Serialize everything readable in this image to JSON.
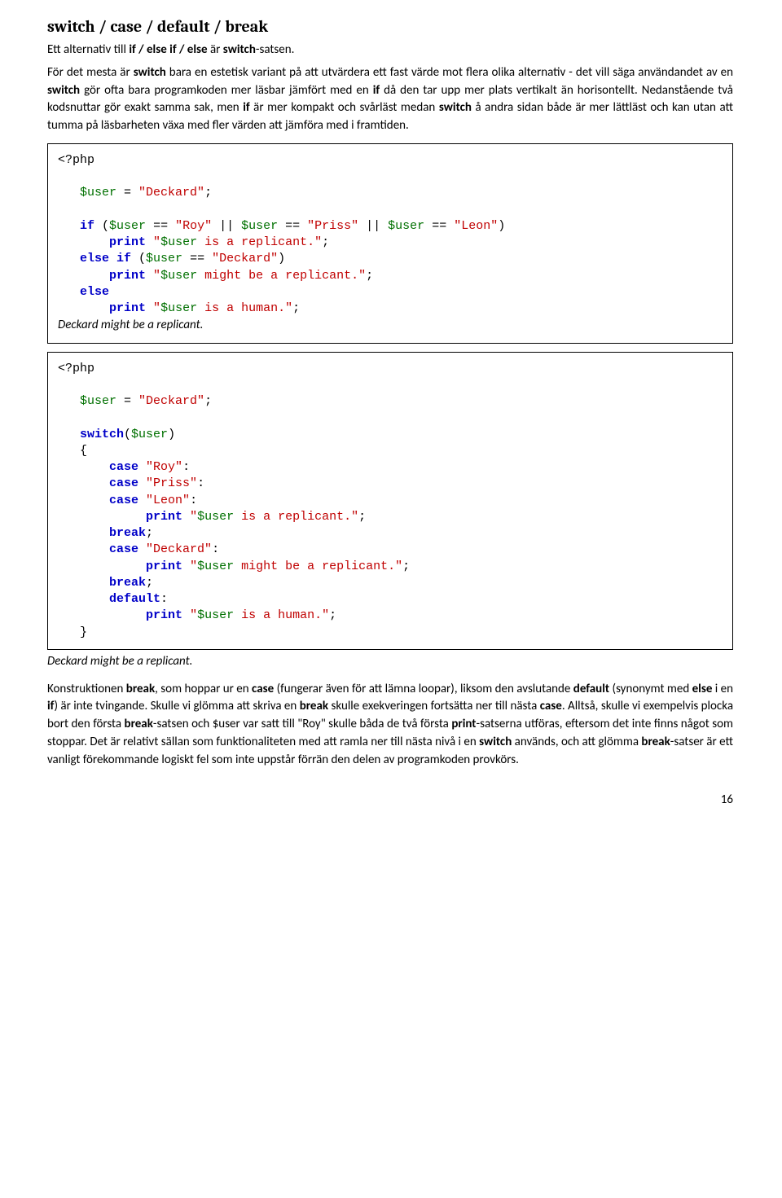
{
  "heading": "switch / case / default / break",
  "para1_pre": "Ett alternativ till ",
  "para1_b1": "if / else if / else",
  "para1_post": " är ",
  "para1_b2": "switch",
  "para1_end": "-satsen.",
  "para2": {
    "t1": "För det mesta är ",
    "b1": "switch",
    "t2": " bara en estetisk variant på att utvärdera ett fast värde mot flera olika alternativ - det vill säga användandet av en ",
    "b2": "switch",
    "t3": " gör ofta bara programkoden mer läsbar jämfört med en ",
    "b3": "if",
    "t4": " då den tar upp mer plats vertikalt än horisontellt. Nedanstående två kodsnuttar gör exakt samma sak, men ",
    "b4": "if",
    "t5": " är mer kompakt och svårläst medan ",
    "b5": "switch",
    "t6": " å andra sidan både är mer lättläst och kan utan att tumma på läsbarheten växa med fler värden att jämföra med i framtiden."
  },
  "code1": {
    "php_open": "<?php",
    "user": "$user",
    "eq": " = ",
    "deckard": "\"Deckard\"",
    "semi": ";",
    "if_kw": "if",
    "open_paren": " (",
    "eqeq": " == ",
    "roy": "\"Roy\"",
    "or": " || ",
    "priss": "\"Priss\"",
    "leon": "\"Leon\"",
    "close_paren": ")",
    "print_kw": "print",
    "sp": " ",
    "str_replicant_a": "\"",
    "str_replicant_b": " is a replicant.\"",
    "else_kw": "else",
    "elseif_kw": "else if",
    "str_might_b": " might be a replicant.\"",
    "str_human_b": " is a human.\"",
    "output": "Deckard might be a replicant."
  },
  "code2": {
    "php_open": "<?php",
    "switch_kw": "switch",
    "case_kw": "case",
    "break_kw": "break",
    "default_kw": "default",
    "colon": ":",
    "lbrace": "{",
    "rbrace": "}",
    "output": "Deckard might be a replicant."
  },
  "para3": {
    "t1": "Konstruktionen ",
    "b1": "break",
    "t2": ", som hoppar ur en ",
    "b2": "case",
    "t3": " (fungerar även för att lämna loopar), liksom den avslutande ",
    "b3": "default",
    "t4": " (synonymt med ",
    "b4": "else",
    "t5": " i en ",
    "b5": "if",
    "t6": ") är inte tvingande. Skulle vi glömma att skriva en ",
    "b6": "break",
    "t7": " skulle exekveringen fortsätta ner till nästa ",
    "b7": "case",
    "t8": ". Alltså, skulle vi exempelvis plocka bort den första ",
    "b8": "break",
    "t9": "-satsen och $user var satt till \"Roy\" skulle båda de två första ",
    "b9": "print",
    "t10": "-satserna utföras, eftersom det inte finns något som stoppar. Det är relativt sällan som funktionaliteten med att ramla ner till nästa nivå i en ",
    "b10": "switch",
    "t11": " används, och att glömma ",
    "b11": "break",
    "t12": "-satser är ett vanligt förekommande logiskt fel som inte uppstår förrän den delen av programkoden provkörs."
  },
  "pagenum": "16"
}
